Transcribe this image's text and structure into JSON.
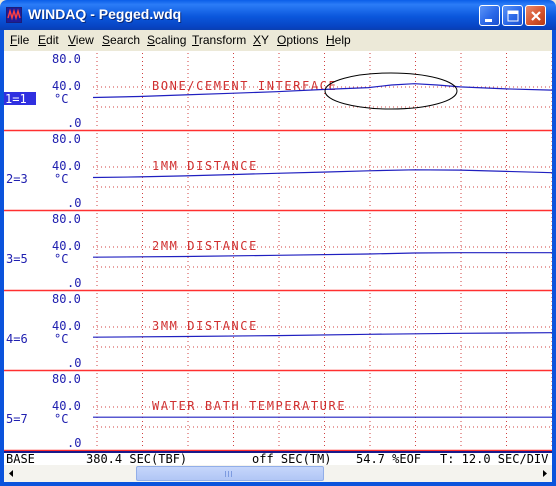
{
  "window": {
    "title": "WINDAQ - Pegged.wdq",
    "app_icon": "windaq-logo-icon",
    "buttons": [
      "minimize",
      "maximize",
      "close"
    ]
  },
  "menu": {
    "items": [
      {
        "label": "File",
        "mnemonic": "F",
        "rest": "ile"
      },
      {
        "label": "Edit",
        "mnemonic": "E",
        "rest": "dit"
      },
      {
        "label": "View",
        "mnemonic": "V",
        "rest": "iew"
      },
      {
        "label": "Search",
        "mnemonic": "S",
        "rest": "earch"
      },
      {
        "label": "Scaling",
        "mnemonic": "S",
        "rest": "caling"
      },
      {
        "label": "Transform",
        "mnemonic": "T",
        "rest": "ransform"
      },
      {
        "label": "XY",
        "mnemonic": "X",
        "rest": "Y"
      },
      {
        "label": "Options",
        "mnemonic": "O",
        "rest": "ptions"
      },
      {
        "label": "Help",
        "mnemonic": "H",
        "rest": "elp"
      }
    ]
  },
  "colors": {
    "divider": "#ff3030",
    "grid": "#d04040",
    "trace": "#2020c0",
    "label_text": "#d03030",
    "axis_text": "#2020b0",
    "selected_channel_bg": "#3030e0"
  },
  "chart_data": {
    "type": "line",
    "x_units": "SEC",
    "channels": [
      {
        "id": "1=1",
        "selected": true,
        "top": "80.0",
        "mid": "40.0",
        "unit": "°C",
        "bottom": ".0",
        "label": "BONE/CEMENT INTERFACE",
        "annotation": "ellipse",
        "points": [
          [
            0,
            37.7
          ],
          [
            0.1,
            38.0
          ],
          [
            0.2,
            38.5
          ],
          [
            0.3,
            39.0
          ],
          [
            0.4,
            39.5
          ],
          [
            0.5,
            40.2
          ],
          [
            0.6,
            40.8
          ],
          [
            0.65,
            41.6
          ],
          [
            0.7,
            42.0
          ],
          [
            0.75,
            41.6
          ],
          [
            0.8,
            41.0
          ],
          [
            0.9,
            40.4
          ],
          [
            1,
            40.0
          ]
        ]
      },
      {
        "id": "2=3",
        "selected": false,
        "top": "80.0",
        "mid": "40.0",
        "unit": "°C",
        "bottom": ".0",
        "label": "1MM DISTANCE",
        "points": [
          [
            0,
            37.7
          ],
          [
            0.1,
            37.9
          ],
          [
            0.2,
            38.2
          ],
          [
            0.3,
            38.6
          ],
          [
            0.4,
            39.0
          ],
          [
            0.5,
            39.4
          ],
          [
            0.6,
            39.8
          ],
          [
            0.7,
            40.1
          ],
          [
            0.8,
            40.0
          ],
          [
            0.9,
            39.6
          ],
          [
            1,
            39.2
          ]
        ]
      },
      {
        "id": "3=5",
        "selected": false,
        "top": "80.0",
        "mid": "40.0",
        "unit": "°C",
        "bottom": ".0",
        "label": "2MM DISTANCE",
        "points": [
          [
            0,
            37.8
          ],
          [
            0.2,
            38.0
          ],
          [
            0.4,
            38.4
          ],
          [
            0.6,
            38.8
          ],
          [
            0.7,
            39.1
          ],
          [
            0.8,
            39.2
          ],
          [
            1,
            39.2
          ]
        ]
      },
      {
        "id": "4=6",
        "selected": false,
        "top": "80.0",
        "mid": "40.0",
        "unit": "°C",
        "bottom": ".0",
        "label": "3MM DISTANCE",
        "points": [
          [
            0,
            37.8
          ],
          [
            0.2,
            38.0
          ],
          [
            0.4,
            38.3
          ],
          [
            0.6,
            38.7
          ],
          [
            0.8,
            39.0
          ],
          [
            1,
            39.2
          ]
        ]
      },
      {
        "id": "5=7",
        "selected": false,
        "top": "80.0",
        "mid": "40.0",
        "unit": "°C",
        "bottom": ".0",
        "label": "WATER BATH TEMPERATURE",
        "points": [
          [
            0,
            37.8
          ],
          [
            0.5,
            37.8
          ],
          [
            1,
            37.8
          ]
        ]
      }
    ]
  },
  "status": {
    "base": "BASE",
    "time_per_div": "380.4 SEC(TBF)",
    "cursor_time": "off SEC(TM)",
    "eof": "54.7 %EOF",
    "tail": "T: 12.0 SEC/DIV"
  }
}
